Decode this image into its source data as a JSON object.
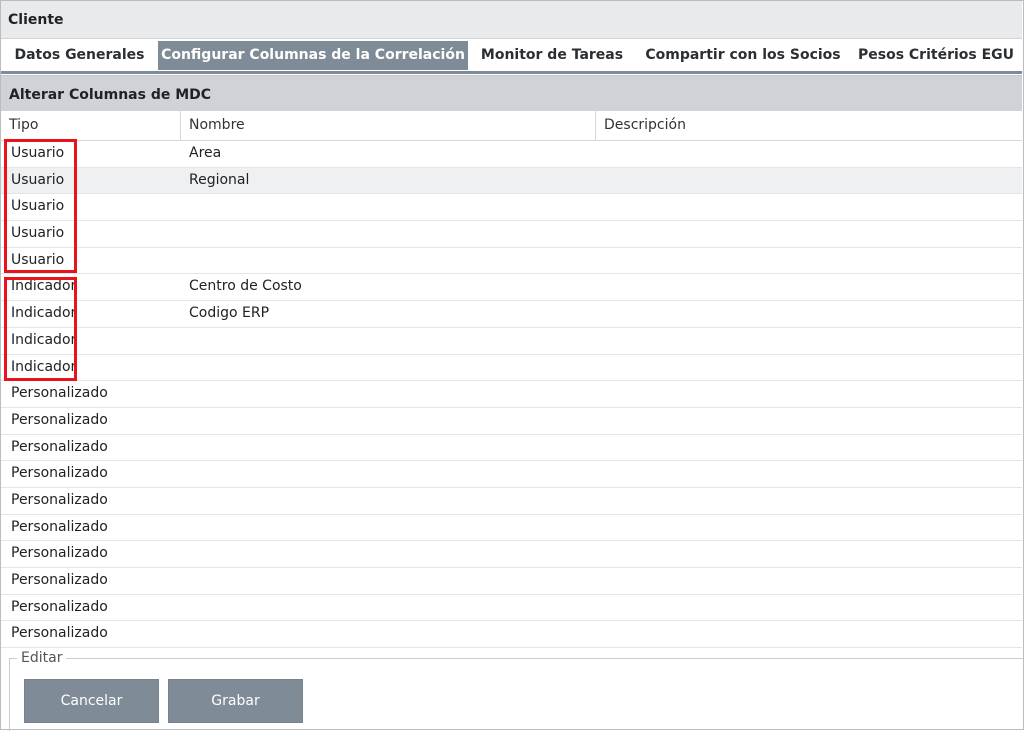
{
  "window": {
    "title": "Cliente"
  },
  "tabs": [
    {
      "label": "Datos Generales",
      "active": false
    },
    {
      "label": "Configurar Columnas de la Correlación",
      "active": true
    },
    {
      "label": "Monitor de Tareas",
      "active": false
    },
    {
      "label": "Compartir con los Socios",
      "active": false
    },
    {
      "label": "Pesos Critérios EGU",
      "active": false
    }
  ],
  "section": {
    "title": "Alterar Columnas de MDC"
  },
  "table": {
    "columns": [
      "Tipo",
      "Nombre",
      "Descripción"
    ],
    "rows": [
      {
        "tipo": "Usuario",
        "nombre": "Area",
        "descripcion": ""
      },
      {
        "tipo": "Usuario",
        "nombre": "Regional",
        "descripcion": ""
      },
      {
        "tipo": "Usuario",
        "nombre": "",
        "descripcion": ""
      },
      {
        "tipo": "Usuario",
        "nombre": "",
        "descripcion": ""
      },
      {
        "tipo": "Usuario",
        "nombre": "",
        "descripcion": ""
      },
      {
        "tipo": "Indicador",
        "nombre": "Centro de Costo",
        "descripcion": ""
      },
      {
        "tipo": "Indicador",
        "nombre": "Codigo ERP",
        "descripcion": ""
      },
      {
        "tipo": "Indicador",
        "nombre": "",
        "descripcion": ""
      },
      {
        "tipo": "Indicador",
        "nombre": "",
        "descripcion": ""
      },
      {
        "tipo": "Personalizado",
        "nombre": "",
        "descripcion": ""
      },
      {
        "tipo": "Personalizado",
        "nombre": "",
        "descripcion": ""
      },
      {
        "tipo": "Personalizado",
        "nombre": "",
        "descripcion": ""
      },
      {
        "tipo": "Personalizado",
        "nombre": "",
        "descripcion": ""
      },
      {
        "tipo": "Personalizado",
        "nombre": "",
        "descripcion": ""
      },
      {
        "tipo": "Personalizado",
        "nombre": "",
        "descripcion": ""
      },
      {
        "tipo": "Personalizado",
        "nombre": "",
        "descripcion": ""
      },
      {
        "tipo": "Personalizado",
        "nombre": "",
        "descripcion": ""
      },
      {
        "tipo": "Personalizado",
        "nombre": "",
        "descripcion": ""
      },
      {
        "tipo": "Personalizado",
        "nombre": "",
        "descripcion": ""
      }
    ],
    "selected_row": 1
  },
  "edit": {
    "legend": "Editar",
    "cancel_label": "Cancelar",
    "save_label": "Grabar"
  },
  "colors": {
    "accent": "#7f8c97",
    "highlight": "#e8131b"
  }
}
